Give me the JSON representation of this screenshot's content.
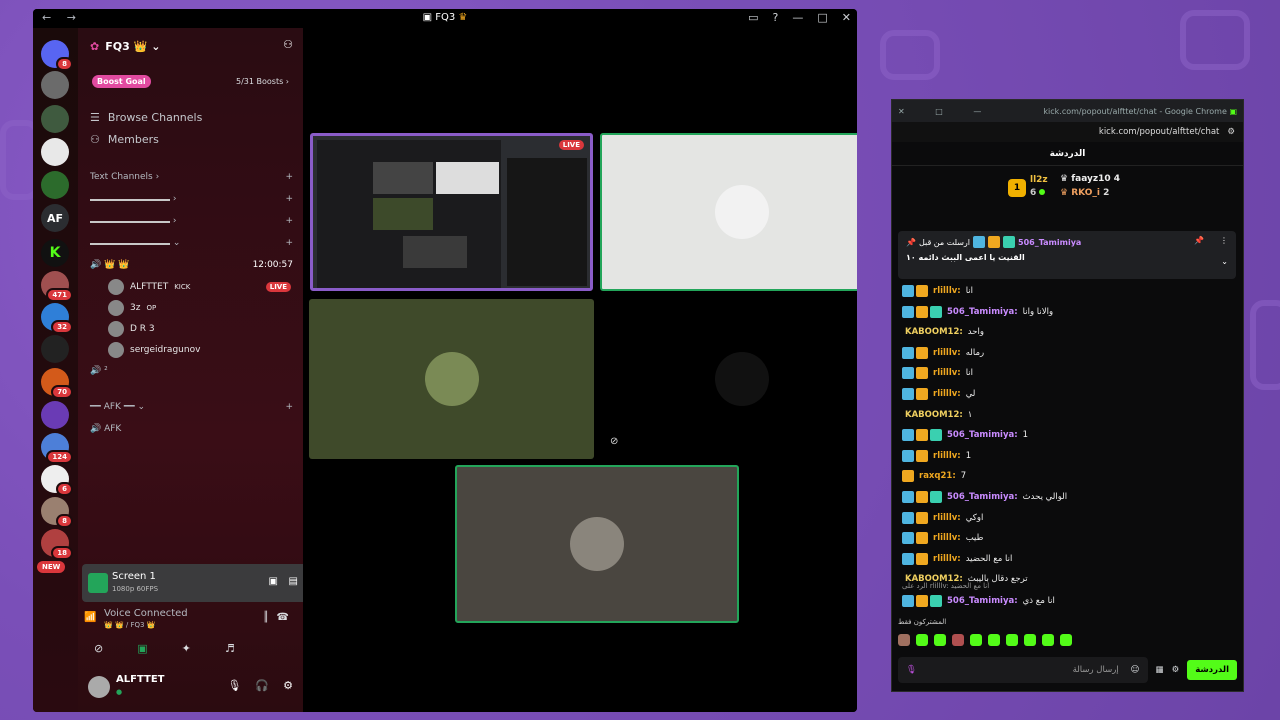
{
  "window": {
    "title": "FQ3",
    "nav": "← →"
  },
  "rail": [
    {
      "name": "discord-home",
      "badge": "8",
      "color": "#5865f2"
    },
    {
      "name": "wolf-server",
      "badge": "",
      "color": "#6b6b6b"
    },
    {
      "name": "tree-server",
      "badge": "",
      "color": "#3f5a3f"
    },
    {
      "name": "fq3-server",
      "badge": "",
      "color": "#e8e8e8"
    },
    {
      "name": "joker-server",
      "badge": "",
      "color": "#2c6b2c"
    },
    {
      "name": "af-server",
      "label": "AF",
      "badge": "",
      "color": "#2b2d31"
    },
    {
      "name": "kick-server",
      "label": "K",
      "badge": "",
      "color": "#111"
    },
    {
      "name": "photo-server-1",
      "badge": "471",
      "color": "#a05050"
    },
    {
      "name": "twitch-server",
      "badge": "32",
      "color": "#2f7fd8"
    },
    {
      "name": "chess-server",
      "badge": "",
      "color": "#222"
    },
    {
      "name": "basketball-server",
      "badge": "70",
      "color": "#d35a1a"
    },
    {
      "name": "purple-server",
      "badge": "",
      "color": "#6a3bb5"
    },
    {
      "name": "game-server",
      "badge": "124",
      "color": "#4d7fd8"
    },
    {
      "name": "tr-server",
      "badge": "6",
      "color": "#eee"
    },
    {
      "name": "photo-server-2",
      "badge": "8",
      "color": "#9a8070"
    },
    {
      "name": "kaji-server",
      "badge": "18",
      "color": "#b04040"
    }
  ],
  "new_label": "NEW",
  "server": {
    "name": "FQ3 👑",
    "boost_pill": "Boost Goal",
    "boost_count": "5/31 Boosts"
  },
  "nav_items": [
    {
      "label": "Browse Channels",
      "icon": "hash-icon"
    },
    {
      "label": "Members",
      "icon": "members-icon"
    }
  ],
  "text_channels_label": "Text Channels",
  "voice_channel": {
    "time": "12:00:57",
    "crowns": "👑 👑"
  },
  "voice_users": [
    {
      "name": "ALFTTET",
      "extra": "KICK",
      "live": "LIVE"
    },
    {
      "name": "3z",
      "extra": "OP",
      "live": ""
    },
    {
      "name": "D R 3",
      "extra": "",
      "live": ""
    },
    {
      "name": "sergeidragunov",
      "extra": "",
      "live": ""
    }
  ],
  "voice_channel2": "²",
  "afk_category": "AFK",
  "afk_channel": "AFK",
  "screen": {
    "title": "Screen 1",
    "sub": "1080p 60FPS"
  },
  "voice_connected": {
    "title": "Voice Connected",
    "sub": "👑 👑 / FQ3 👑"
  },
  "user": {
    "name": "ALFTTET",
    "status": "●"
  },
  "live_badge": "LIVE",
  "kick": {
    "window_title": "kick.com/popout/alfttet/chat - Google Chrome",
    "url": "kick.com/popout/alfttet/chat",
    "chat_label": "الدردشة",
    "leaderboard": [
      {
        "rank": "1",
        "name": "ll2z",
        "count": "6"
      },
      {
        "name": "faayz10",
        "count": "4"
      },
      {
        "name": "RKO_i",
        "count": "2"
      }
    ],
    "pinned_by": "506_Tamimiya",
    "pinned_by_label": "ارسلت من قبل",
    "pinned_text": "القنيت يا اعمى الببث دائمه ١٠",
    "messages": [
      {
        "user": "rlilllv",
        "text": "انا",
        "color": "#f0a820",
        "badges": "vc"
      },
      {
        "user": "506_Tamimiya",
        "text": "والانا وانا",
        "color": "#c98bff",
        "badges": "vcg"
      },
      {
        "user": "KABOOM12",
        "text": "واحد",
        "color": "#f0d060",
        "badges": ""
      },
      {
        "user": "rlilllv",
        "text": "رماله",
        "color": "#f0a820",
        "badges": "vc"
      },
      {
        "user": "rlilllv",
        "text": "انا",
        "color": "#f0a820",
        "badges": "vc"
      },
      {
        "user": "rlilllv",
        "text": "لي",
        "color": "#f0a820",
        "badges": "vc"
      },
      {
        "user": "KABOOM12",
        "text": "١",
        "color": "#f0d060",
        "badges": ""
      },
      {
        "user": "506_Tamimiya",
        "text": "1",
        "color": "#c98bff",
        "badges": "vcg"
      },
      {
        "user": "rlilllv",
        "text": "1",
        "color": "#f0a820",
        "badges": "vc"
      },
      {
        "user": "raxq21",
        "text": "7",
        "color": "#f0a820",
        "badges": "c"
      },
      {
        "user": "506_Tamimiya",
        "text": "الوالي يحدث",
        "color": "#c98bff",
        "badges": "vcg"
      },
      {
        "user": "rlilllv",
        "text": "اوكي",
        "color": "#f0a820",
        "badges": "vc"
      },
      {
        "user": "rlilllv",
        "text": "طيب",
        "color": "#f0a820",
        "badges": "vc"
      },
      {
        "user": "rlilllv",
        "text": "انا مع الحضيد",
        "color": "#f0a820",
        "badges": "vc"
      },
      {
        "user": "KABOOM12",
        "text": "ترجع دقال باليبث",
        "color": "#f0d060",
        "badges": ""
      },
      {
        "user": "506_Tamimiya",
        "text": "انا مع ذي",
        "color": "#c98bff",
        "badges": "vcg"
      }
    ],
    "reply_text": "الرد على rlilllv: انا مع الحضيد",
    "subscribers_label": "المشتركون فقط",
    "input_placeholder": "إرسال رسالة",
    "send_label": "الدردشة"
  }
}
